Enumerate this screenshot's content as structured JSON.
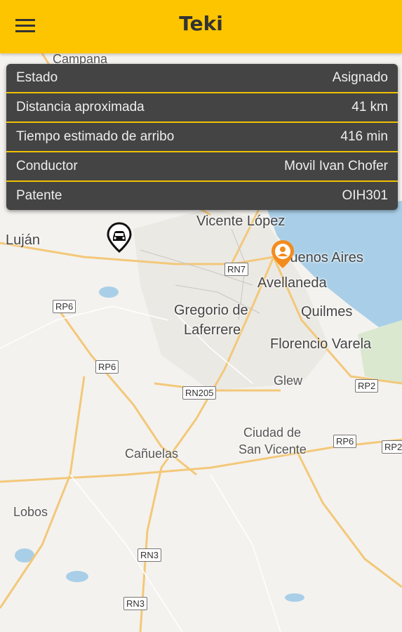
{
  "app": {
    "title": "Teki",
    "menu_icon": "hamburger-menu-icon",
    "accent_color": "#fcc500",
    "panel_color": "#444444",
    "divider_color": "#f0c000"
  },
  "info_panel": {
    "rows": [
      {
        "label": "Estado",
        "value": "Asignado"
      },
      {
        "label": "Distancia aproximada",
        "value": "41 km"
      },
      {
        "label": "Tiempo estimado de arribo",
        "value": "416 min"
      },
      {
        "label": "Conductor",
        "value": "Movil Ivan Chofer"
      },
      {
        "label": "Patente",
        "value": "OIH301"
      }
    ]
  },
  "map": {
    "places": {
      "campana": "Campana",
      "vicente_lopez": "Vicente López",
      "lujan": "Luján",
      "buenos_aires": "Buenos Aires",
      "avellaneda": "Avellaneda",
      "gregorio_1": "Gregorio de",
      "gregorio_2": "Laferrere",
      "quilmes": "Quilmes",
      "florencio_varela": "Florencio Varela",
      "glew": "Glew",
      "ciudad_1": "Ciudad de",
      "ciudad_2": "San Vicente",
      "canuelas": "Cañuelas",
      "lobos": "Lobos"
    },
    "routes": {
      "rn7": "RN7",
      "rp6_a": "RP6",
      "rp6_b": "RP6",
      "rn205": "RN205",
      "rp2_a": "RP2",
      "rp6_c": "RP6",
      "rp2_b": "RP2",
      "rn3_a": "RN3",
      "rn3_b": "RN3"
    },
    "markers": {
      "vehicle": "car-marker-icon",
      "user": "person-marker-icon",
      "user_color": "#f28c1e"
    }
  }
}
